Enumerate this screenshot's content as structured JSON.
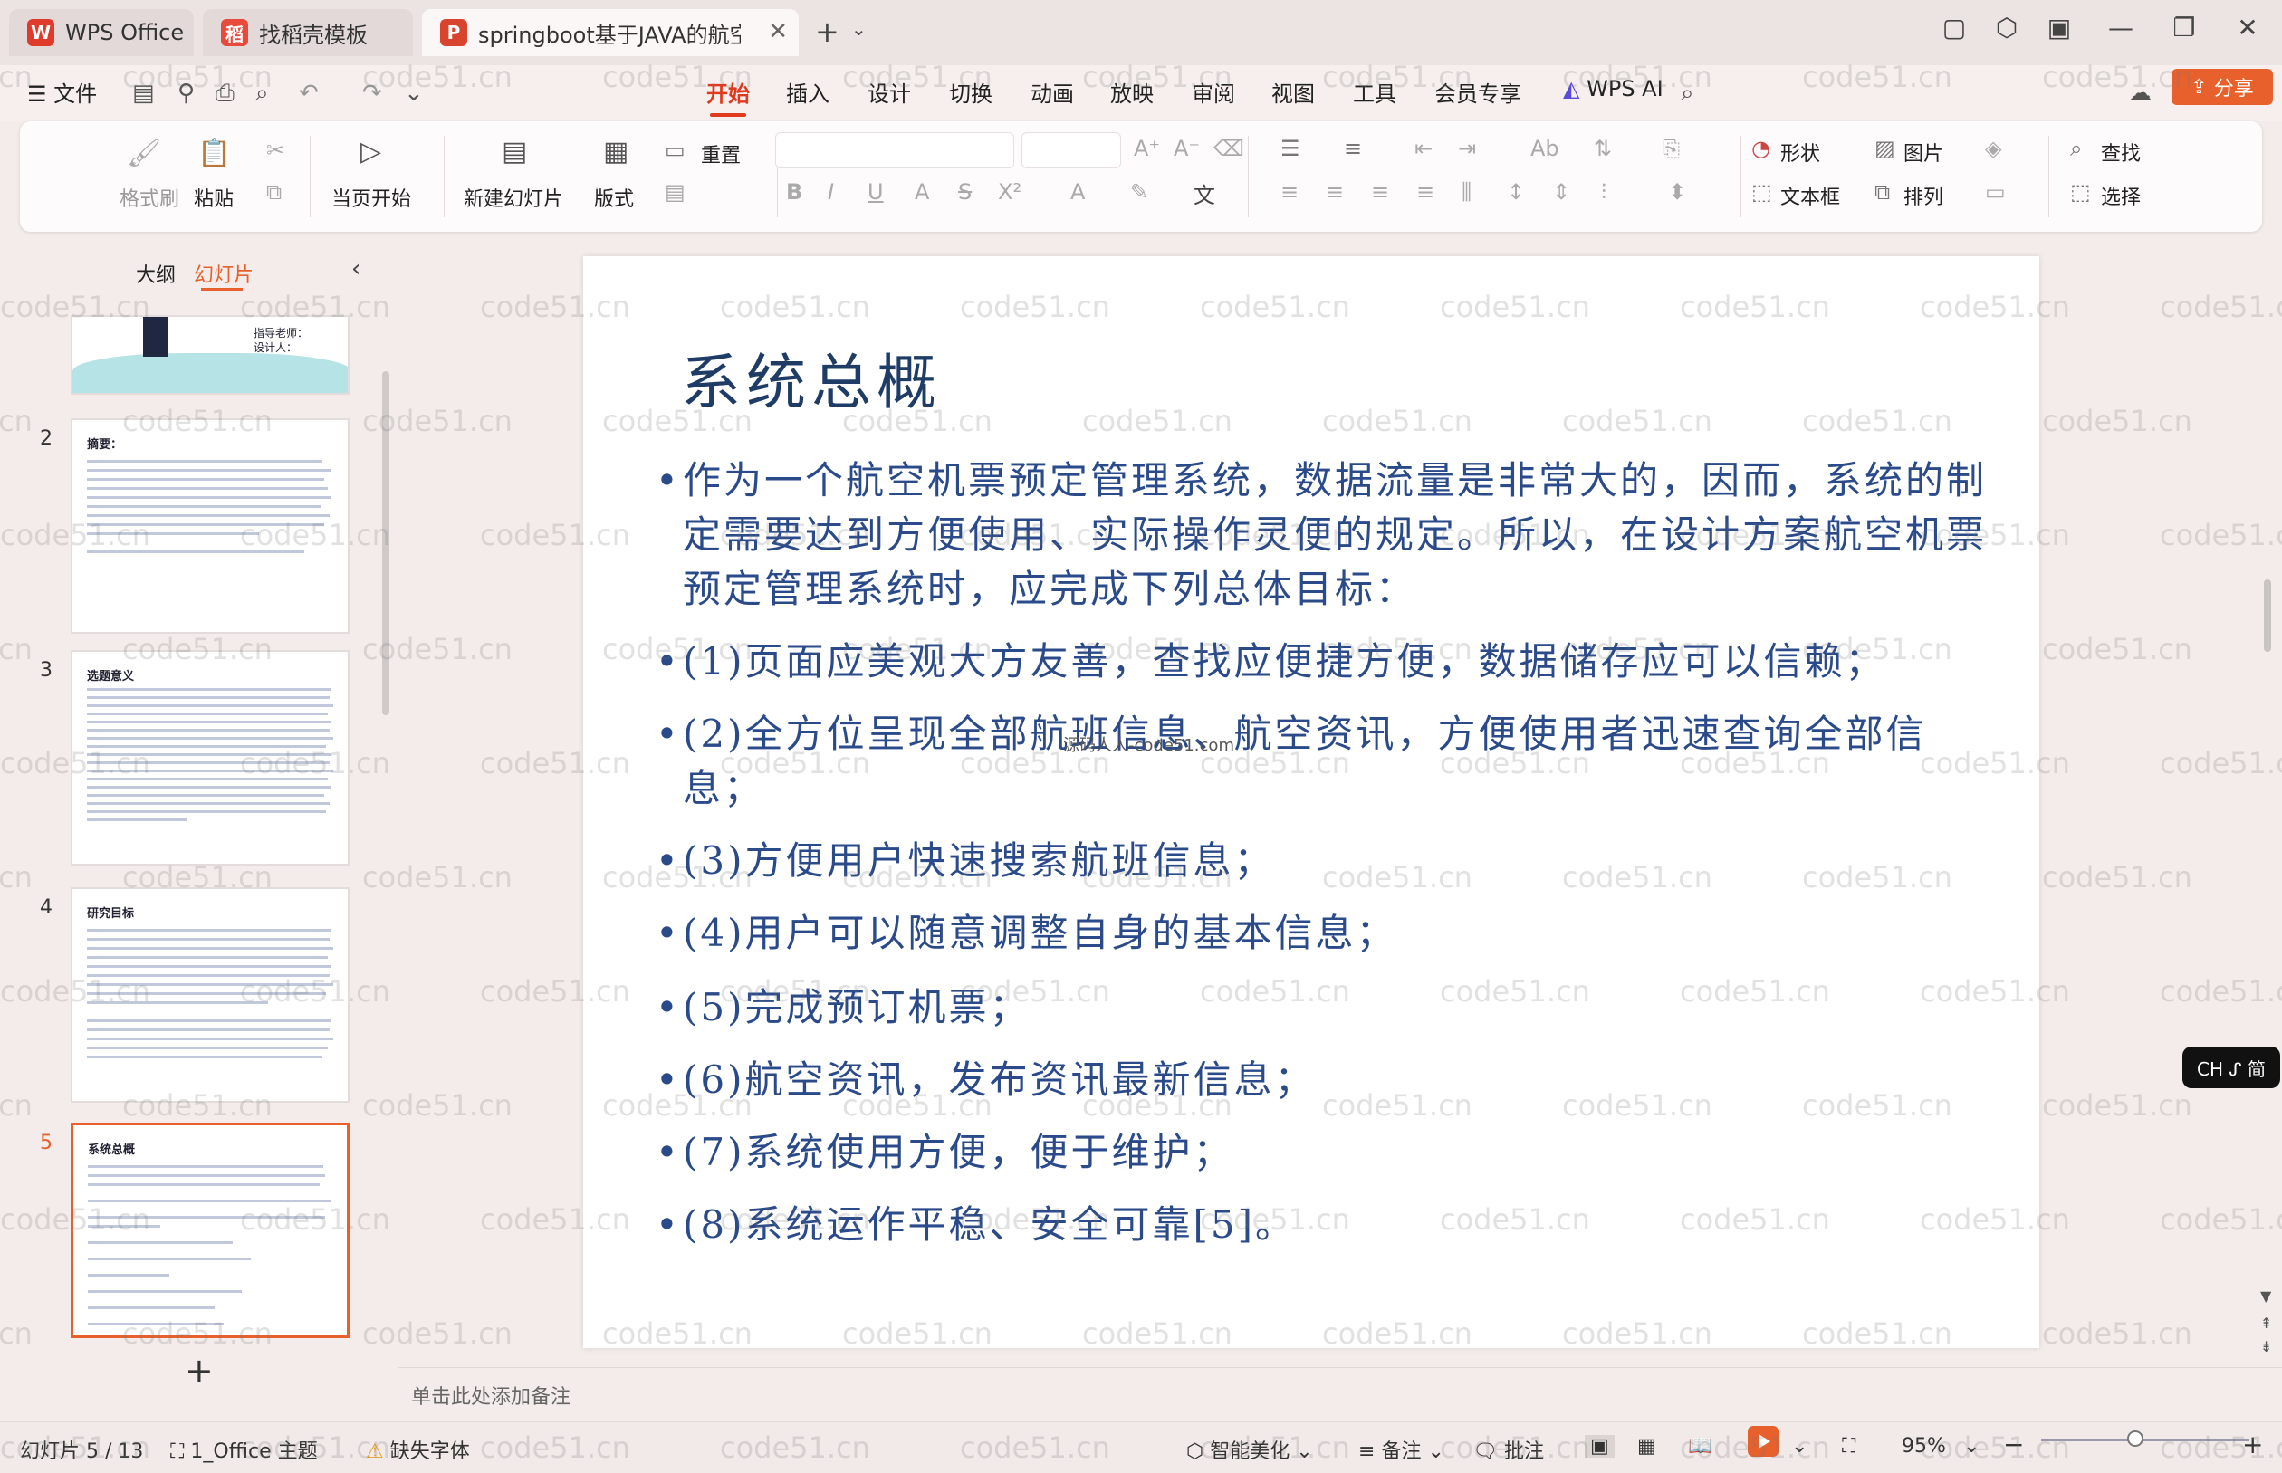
{
  "tabs": [
    {
      "icon": "W",
      "label": "WPS Office",
      "color": "#e03a2a"
    },
    {
      "icon": "稻",
      "label": "找稻壳模板",
      "color": "#e84a3c"
    },
    {
      "icon": "P",
      "label": "springboot基于JAVA的航空机",
      "color": "#d9442e"
    }
  ],
  "menu": {
    "file": "文件",
    "items": [
      "开始",
      "插入",
      "设计",
      "切换",
      "动画",
      "放映",
      "审阅",
      "视图",
      "工具",
      "会员专享"
    ],
    "active": "开始",
    "ai": "WPS AI",
    "share": "分享"
  },
  "ribbon": {
    "format_painter": "格式刷",
    "paste": "粘贴",
    "play_from_current": "当页开始",
    "new_slide": "新建幻灯片",
    "layout": "版式",
    "reset": "重置",
    "shape": "形状",
    "picture": "图片",
    "find": "查找",
    "textbox": "文本框",
    "arrange": "排列",
    "select": "选择"
  },
  "panel": {
    "outline_tab": "大纲",
    "slides_tab": "幻灯片",
    "add_label": "+"
  },
  "thumbnails": [
    {
      "num": "",
      "title": "指导老师：\n设计人："
    },
    {
      "num": "2",
      "title": "摘要："
    },
    {
      "num": "3",
      "title": "选题意义"
    },
    {
      "num": "4",
      "title": "研究目标"
    },
    {
      "num": "5",
      "title": "系统总概"
    }
  ],
  "slide": {
    "title": "系统总概",
    "bullets": [
      "作为一个航空机票预定管理系统，数据流量是非常大的，因而，系统的制定需要达到方便使用、实际操作灵便的规定。所以，在设计方案航空机票预定管理系统时，应完成下列总体目标：",
      "(1)页面应美观大方友善，查找应便捷方便，数据储存应可以信赖；",
      "(2)全方位呈现全部航班信息、航空资讯，方便使用者迅速查询全部信息；",
      "(3)方便用户快速搜索航班信息；",
      "(4)用户可以随意调整自身的基本信息；",
      "(5)完成预订机票；",
      "(6)航空资讯，发布资讯最新信息；",
      "(7)系统使用方便，便于维护；",
      "(8)系统运作平稳、安全可靠[5]。"
    ],
    "stamp": "源码人人-code51.com"
  },
  "notes_placeholder": "单击此处添加备注",
  "status": {
    "slide_count": "幻灯片 5 / 13",
    "theme": "1_Office 主题",
    "missing_font": "缺失字体",
    "beautify": "智能美化",
    "notes": "备注",
    "comment": "批注",
    "zoom": "95%",
    "zoom_level": 0.45
  },
  "ime": "CH ᔑ 简",
  "watermark": "code51.cn"
}
